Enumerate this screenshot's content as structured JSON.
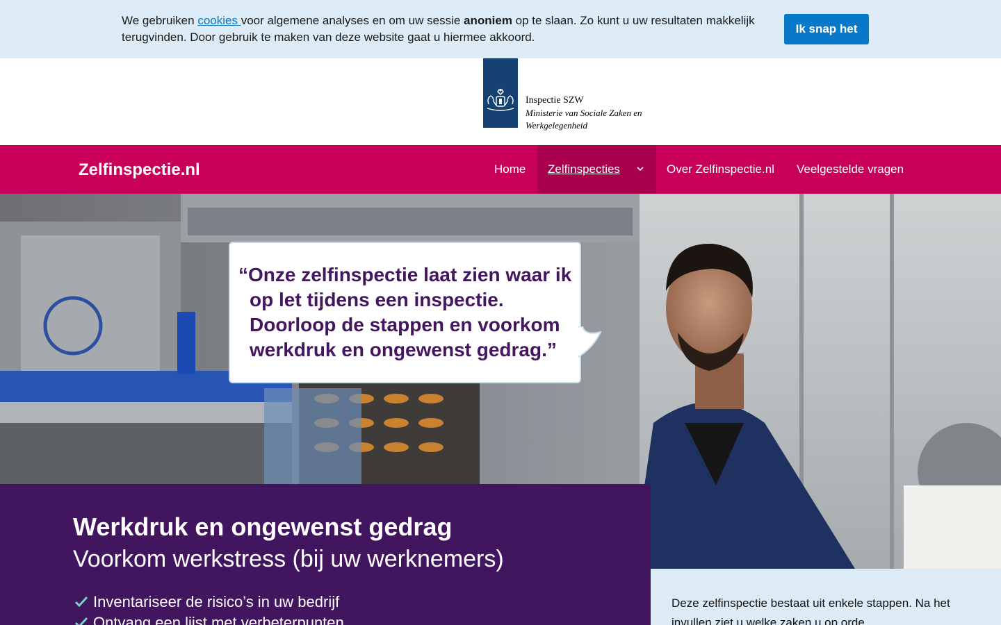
{
  "cookie_bar": {
    "text_before": "We gebruiken ",
    "link": "cookies ",
    "text_middle": "voor algemene analyses en om uw sessie ",
    "bold": "anoniem",
    "text_after": " op te slaan. Zo kunt u uw resultaten makkelijk terugvinden. Door gebruik te maken van deze website gaat u hiermee akkoord.",
    "button": "Ik snap het"
  },
  "logo": {
    "line1": "Inspectie SZW",
    "line2": "Ministerie van Sociale Zaken en",
    "line3": "Werkgelegenheid"
  },
  "nav": {
    "brand": "Zelfinspectie.nl",
    "items": [
      "Home",
      "Zelfinspecties",
      "Over Zelfinspectie.nl",
      "Veelgestelde vragen"
    ]
  },
  "hero": {
    "quote": "“Onze zelfinspectie laat zien waar ik op let tijdens een inspectie. Doorloop de stappen en voorkom werkdruk en ongewenst gedrag.”"
  },
  "intro": {
    "title": "Werkdruk en ongewenst gedrag",
    "subtitle": "Voorkom werkstress (bij uw werknemers)",
    "checklist": [
      "Inventariseer de risico’s in uw bedrijf",
      "Ontvang een lijst met verbeterpunten"
    ]
  },
  "info": {
    "text": "Deze zelfinspectie bestaat uit enkele stappen. Na het invullen ziet u welke zaken u op orde"
  },
  "colors": {
    "nav_magenta": "#c8005a",
    "purple": "#42155f",
    "light_blue": "#dcebf6",
    "button_blue": "#0879c9",
    "check_teal": "#78d2c8"
  }
}
